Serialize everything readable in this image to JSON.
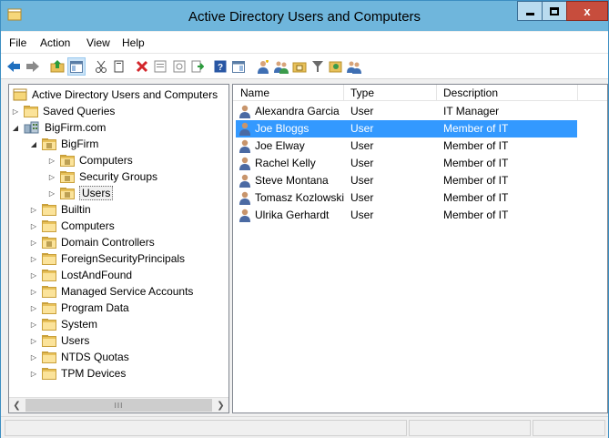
{
  "window": {
    "title": "Active Directory Users and Computers",
    "close_glyph": "x"
  },
  "menu": [
    "File",
    "Action",
    "View",
    "Help"
  ],
  "toolbar": {
    "icons": [
      "back-arrow-icon",
      "forward-arrow-icon",
      "up-folder-icon",
      "show-console-tree-icon",
      "cut-icon",
      "copy-icon",
      "delete-icon",
      "properties-icon",
      "refresh-icon",
      "export-list-icon",
      "help-icon",
      "show-action-pane-icon",
      "new-user-icon",
      "new-group-icon",
      "new-ou-icon",
      "filter-icon",
      "add-to-group-icon",
      "delegate-icon"
    ]
  },
  "tree": {
    "root": "Active Directory Users and Computers",
    "saved_queries": "Saved Queries",
    "domain": "BigFirm.com",
    "ou": "BigFirm",
    "ou_children": [
      "Computers",
      "Security Groups",
      "Users"
    ],
    "containers": [
      "Builtin",
      "Computers",
      "Domain Controllers",
      "ForeignSecurityPrincipals",
      "LostAndFound",
      "Managed Service Accounts",
      "Program Data",
      "System",
      "Users",
      "NTDS Quotas",
      "TPM Devices"
    ],
    "scroll_thumb": "III"
  },
  "list": {
    "columns": [
      "Name",
      "Type",
      "Description"
    ],
    "rows": [
      {
        "name": "Alexandra Garcia",
        "type": "User",
        "description": "IT Manager"
      },
      {
        "name": "Joe Bloggs",
        "type": "User",
        "description": "Member of IT"
      },
      {
        "name": "Joe Elway",
        "type": "User",
        "description": "Member of IT"
      },
      {
        "name": "Rachel Kelly",
        "type": "User",
        "description": "Member of IT"
      },
      {
        "name": "Steve Montana",
        "type": "User",
        "description": "Member of IT"
      },
      {
        "name": "Tomasz Kozlowski",
        "type": "User",
        "description": "Member of IT"
      },
      {
        "name": "Ulrika Gerhardt",
        "type": "User",
        "description": "Member of IT"
      }
    ],
    "selected_index": 1
  },
  "colors": {
    "titlebar": "#6fb6dc",
    "selection": "#3399ff",
    "close_button": "#c74d3d"
  }
}
